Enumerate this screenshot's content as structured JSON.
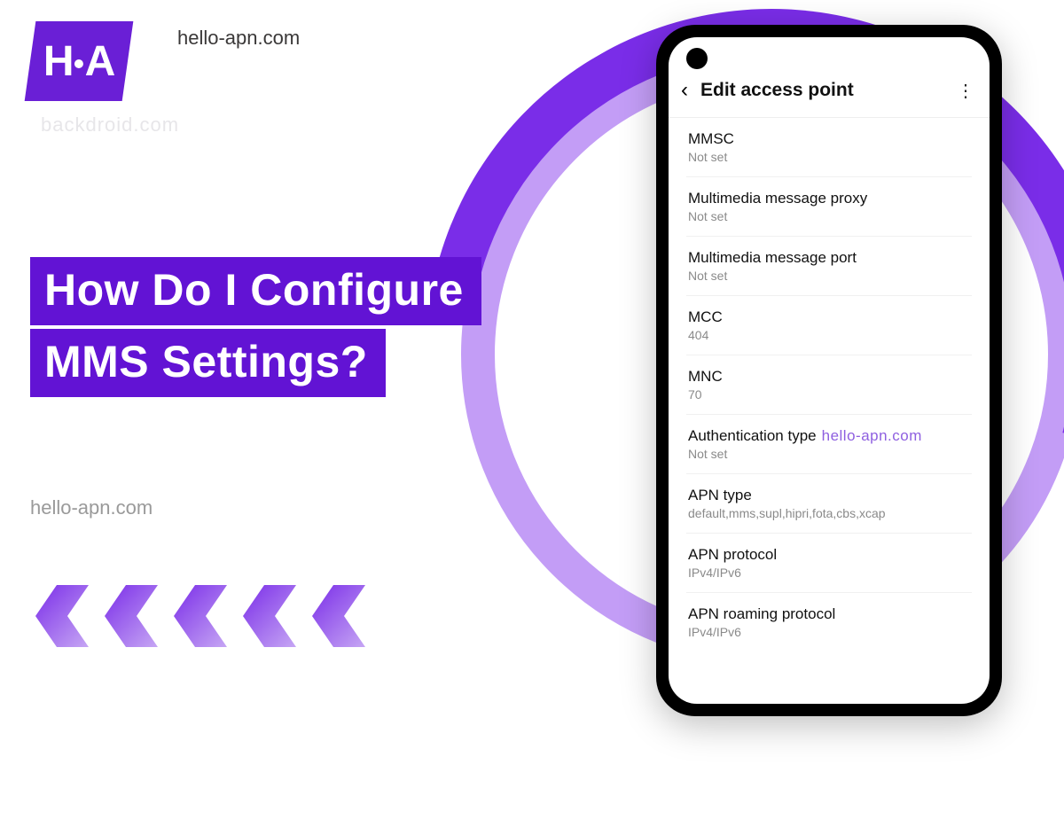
{
  "site": {
    "top_label": "hello-apn.com",
    "watermark": "backdroid.com",
    "bottom_label": "hello-apn.com"
  },
  "logo": {
    "letters": "H A"
  },
  "headline": {
    "line1": "How Do I Configure",
    "line2": "MMS Settings?"
  },
  "phone": {
    "appbar_title": "Edit access point",
    "auth_watermark": "hello-apn.com",
    "rows": [
      {
        "label": "MMSC",
        "value": "Not set"
      },
      {
        "label": "Multimedia message proxy",
        "value": "Not set"
      },
      {
        "label": "Multimedia message port",
        "value": "Not set"
      },
      {
        "label": "MCC",
        "value": "404"
      },
      {
        "label": "MNC",
        "value": "70"
      },
      {
        "label": "Authentication type",
        "value": "Not set"
      },
      {
        "label": "APN type",
        "value": "default,mms,supl,hipri,fota,cbs,xcap"
      },
      {
        "label": "APN protocol",
        "value": "IPv4/IPv6"
      },
      {
        "label": "APN roaming protocol",
        "value": "IPv4/IPv6"
      }
    ]
  }
}
